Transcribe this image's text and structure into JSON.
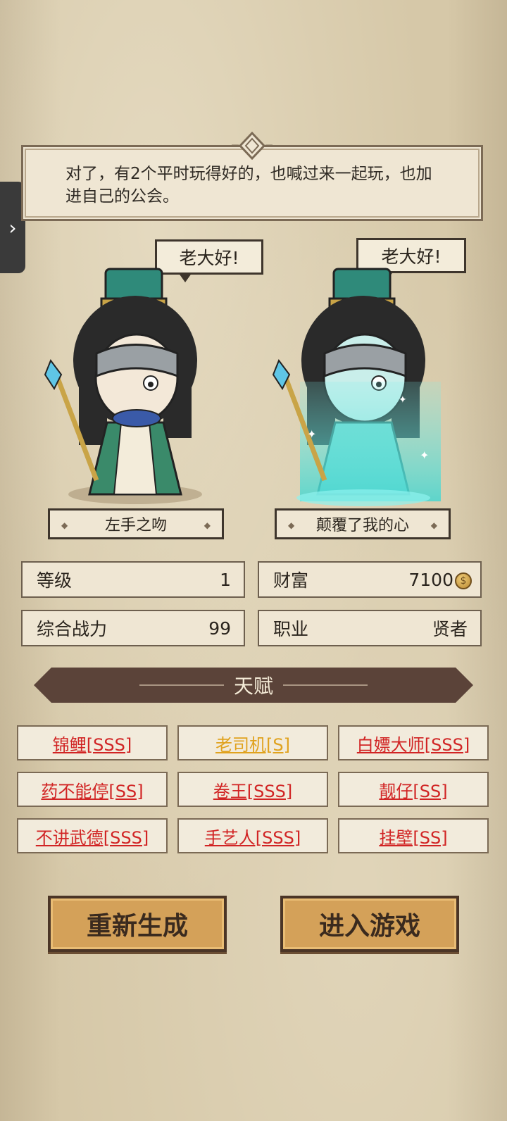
{
  "dialog": {
    "text": "对了，有2个平时玩得好的，也喊过来一起玩，也加进自己的公会。"
  },
  "characters": [
    {
      "bubble": "老大好!",
      "name": "左手之吻"
    },
    {
      "bubble": "老大好!",
      "name": "颠覆了我的心"
    }
  ],
  "stats": {
    "level_label": "等级",
    "level_value": "1",
    "wealth_label": "财富",
    "wealth_value": "7100",
    "power_label": "综合战力",
    "power_value": "99",
    "job_label": "职业",
    "job_value": "贤者"
  },
  "talent_header": "天赋",
  "talents": [
    {
      "label": "锦鲤[SSS]",
      "color": "#d12424"
    },
    {
      "label": "老司机[S]",
      "color": "#e0a21e"
    },
    {
      "label": "白嫖大师[SSS]",
      "color": "#d12424"
    },
    {
      "label": "药不能停[SS]",
      "color": "#d12424"
    },
    {
      "label": "卷王[SSS]",
      "color": "#d12424"
    },
    {
      "label": "靓仔[SS]",
      "color": "#d12424"
    },
    {
      "label": "不讲武德[SSS]",
      "color": "#d12424"
    },
    {
      "label": "手艺人[SSS]",
      "color": "#d12424"
    },
    {
      "label": "挂壁[SS]",
      "color": "#d12424"
    }
  ],
  "buttons": {
    "regenerate": "重新生成",
    "enter": "进入游戏"
  }
}
